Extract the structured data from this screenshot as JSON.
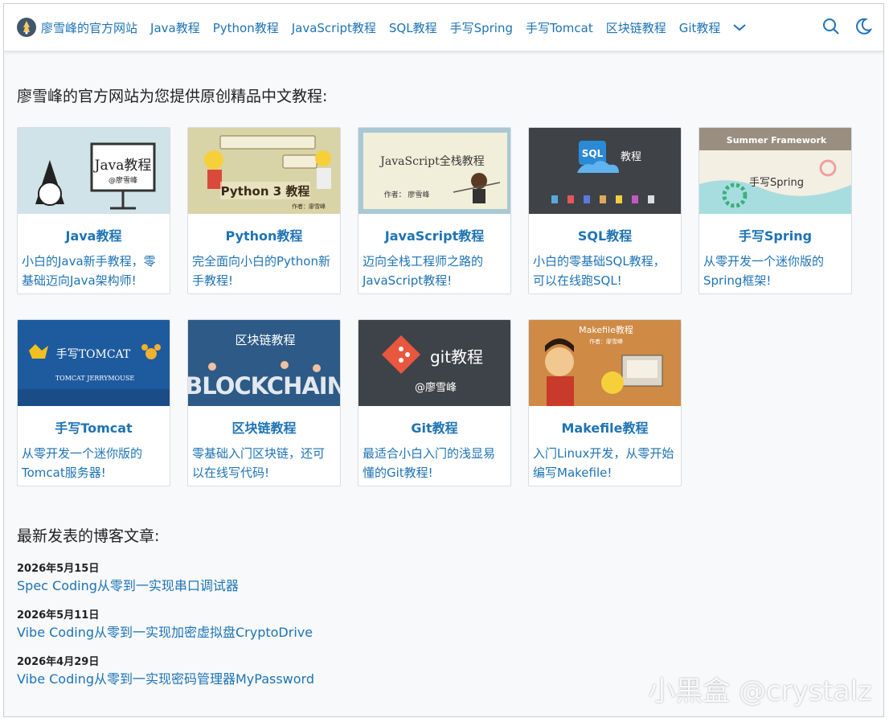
{
  "nav": {
    "brand": "廖雪峰的官方网站",
    "links": [
      "Java教程",
      "Python教程",
      "JavaScript教程",
      "SQL教程",
      "手写Spring",
      "手写Tomcat",
      "区块链教程",
      "Git教程"
    ]
  },
  "intro_title": "廖雪峰的官方网站为您提供原创精品中文教程:",
  "courses": [
    {
      "title": "Java教程",
      "desc": "小白的Java新手教程，零基础迈向Java架构师!",
      "img_text": "Java教程",
      "img_sub": "@廖雪峰"
    },
    {
      "title": "Python教程",
      "desc": "完全面向小白的Python新手教程!",
      "img_text": "Python 3 教程",
      "img_sub": "作者：廖雪峰"
    },
    {
      "title": "JavaScript教程",
      "desc": "迈向全栈工程师之路的JavaScript教程!",
      "img_text": "JavaScript全栈教程",
      "img_sub": "作者： 廖雪峰"
    },
    {
      "title": "SQL教程",
      "desc": "小白的零基础SQL教程，可以在线跑SQL!",
      "img_text": "教程",
      "img_sub": "SQL"
    },
    {
      "title": "手写Spring",
      "desc": "从零开发一个迷你版的Spring框架!",
      "img_text": "手写Spring",
      "img_sub": "Summer Framework"
    },
    {
      "title": "手写Tomcat",
      "desc": "从零开发一个迷你版的Tomcat服务器!",
      "img_text": "手写TOMCAT",
      "img_sub": "TOMCAT  JERRYMOUSE"
    },
    {
      "title": "区块链教程",
      "desc": "零基础入门区块链，还可以在线写代码!",
      "img_text": "区块链教程",
      "img_sub": "BLOCKCHAIN"
    },
    {
      "title": "Git教程",
      "desc": "最适合小白入门的浅显易懂的Git教程!",
      "img_text": "git教程",
      "img_sub": "@廖雪峰"
    },
    {
      "title": "Makefile教程",
      "desc": "入门Linux开发，从零开始编写Makefile!",
      "img_text": "Makefile教程",
      "img_sub": "作者：廖雪峰"
    }
  ],
  "blog_title": "最新发表的博客文章:",
  "posts": [
    {
      "date": "2026年5月15日",
      "title": "Spec Coding从零到一实现串口调试器"
    },
    {
      "date": "2026年5月11日",
      "title": "Vibe Coding从零到一实现加密虚拟盘CryptoDrive"
    },
    {
      "date": "2026年4月29日",
      "title": "Vibe Coding从零到一实现密码管理器MyPassword"
    }
  ],
  "watermark": "小黑盒 @crystalz",
  "colors": {
    "link": "#1e73b5",
    "text": "#222222",
    "background": "#f7f9fb"
  }
}
